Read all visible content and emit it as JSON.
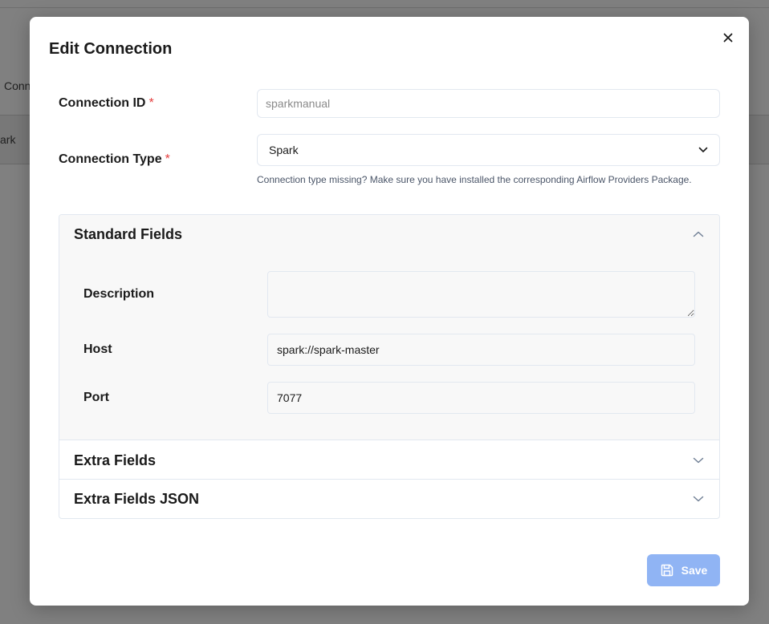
{
  "background": {
    "tab_partial": "Conn",
    "row_partial": "ark"
  },
  "modal": {
    "title": "Edit Connection",
    "close_icon": "close-icon"
  },
  "form": {
    "connection_id": {
      "label": "Connection ID",
      "required_mark": "*",
      "value": "sparkmanual"
    },
    "connection_type": {
      "label": "Connection Type",
      "required_mark": "*",
      "selected": "Spark",
      "helper": "Connection type missing? Make sure you have installed the corresponding Airflow Providers Package."
    }
  },
  "accordion": {
    "standard": {
      "title": "Standard Fields",
      "expanded": true,
      "fields": {
        "description": {
          "label": "Description",
          "value": ""
        },
        "host": {
          "label": "Host",
          "value": "spark://spark-master"
        },
        "port": {
          "label": "Port",
          "value": "7077"
        }
      }
    },
    "extra": {
      "title": "Extra Fields",
      "expanded": false
    },
    "extra_json": {
      "title": "Extra Fields JSON",
      "expanded": false
    }
  },
  "actions": {
    "save_label": "Save",
    "save_icon": "save-icon"
  },
  "colors": {
    "accent_disabled": "#90b4f4",
    "required": "#e53e3e",
    "overlay": "#808080"
  }
}
